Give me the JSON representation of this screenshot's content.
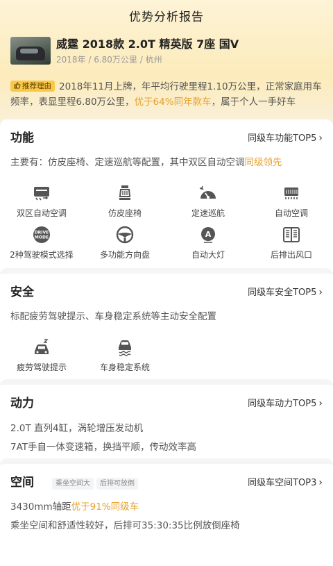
{
  "page": {
    "title": "优势分析报告"
  },
  "car": {
    "name": "威霆 2018款 2.0T 精英版 7座 国V",
    "meta": "2018年 / 6.80万公里 / 杭州"
  },
  "reason": {
    "badge": "推荐理由",
    "text_before": "2018年11月上牌，年平均行驶里程1.10万公里，正常家庭用车频率，表显里程6.80万公里，",
    "highlight": "优于64%同年款车",
    "text_after": "，属于个人一手好车"
  },
  "function": {
    "title": "功能",
    "link": "同级车功能TOP5",
    "desc_before": "主要有：仿皮座椅、定速巡航等配置，其中双区自动空调",
    "desc_highlight": "同级领先",
    "features": [
      {
        "label": "双区自动空调",
        "icon": "dual-zone-ac-icon"
      },
      {
        "label": "仿皮座椅",
        "icon": "leather-seat-icon"
      },
      {
        "label": "定速巡航",
        "icon": "cruise-control-icon"
      },
      {
        "label": "自动空调",
        "icon": "auto-ac-icon"
      },
      {
        "label": "2种驾驶模式选择",
        "icon": "drive-mode-icon"
      },
      {
        "label": "多功能方向盘",
        "icon": "steering-wheel-icon"
      },
      {
        "label": "自动大灯",
        "icon": "auto-headlight-icon"
      },
      {
        "label": "后排出风口",
        "icon": "rear-vent-icon"
      }
    ],
    "drive_mode_text": [
      "DRIVE",
      "MODE"
    ]
  },
  "safety": {
    "title": "安全",
    "link": "同级车安全TOP5",
    "desc": "标配疲劳驾驶提示、车身稳定系统等主动安全配置",
    "features": [
      {
        "label": "疲劳驾驶提示",
        "icon": "fatigue-alert-icon"
      },
      {
        "label": "车身稳定系统",
        "icon": "stability-control-icon"
      }
    ]
  },
  "power": {
    "title": "动力",
    "link": "同级车动力TOP5",
    "lines": [
      "2.0T 直列4缸，涡轮增压发动机",
      "7AT手自一体变速箱，换挡平顺，传动效率高"
    ]
  },
  "space": {
    "title": "空间",
    "link": "同级车空间TOP3",
    "tags": [
      "乘坐空间大",
      "后排可放倒"
    ],
    "line1_before": "3430mm轴距",
    "line1_highlight": "优于91%同级车",
    "line2": "乘坐空间和舒适性较好，后排可35:30:35比例放倒座椅"
  },
  "colors": {
    "accent": "#e7a12a",
    "badge": "#f9c848",
    "icon": "#555555"
  }
}
